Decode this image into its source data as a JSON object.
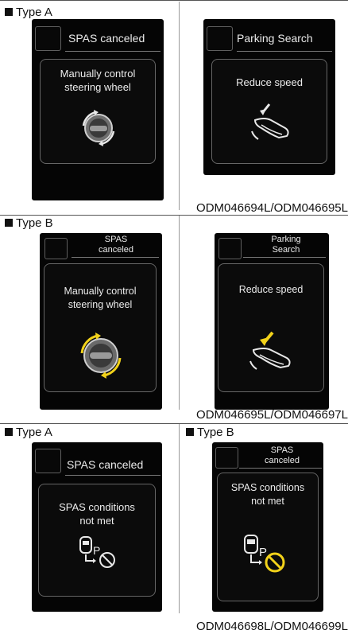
{
  "sections": [
    {
      "label": "Type A",
      "code": "ODM046694L/ODM046695L"
    },
    {
      "label": "Type B",
      "code": "ODM046695L/ODM046697L"
    },
    {
      "label_left": "Type A",
      "label_right": "Type B",
      "code": "ODM046698L/ODM046699L"
    }
  ],
  "screens": {
    "s1": {
      "title": "SPAS canceled",
      "msg_line1": "Manually control",
      "msg_line2": "steering wheel"
    },
    "s2": {
      "title": "Parking Search",
      "msg_line1": "Reduce speed"
    },
    "s3": {
      "title_line1": "SPAS",
      "title_line2": "canceled",
      "msg_line1": "Manually control",
      "msg_line2": "steering wheel"
    },
    "s4": {
      "title_line1": "Parking",
      "title_line2": "Search",
      "msg_line1": "Reduce speed"
    },
    "s5": {
      "title": "SPAS canceled",
      "msg_line1": "SPAS conditions",
      "msg_line2": "not met",
      "icon_letter": "P"
    },
    "s6": {
      "title_line1": "SPAS",
      "title_line2": "canceled",
      "msg_line1": "SPAS conditions",
      "msg_line2": "not met",
      "icon_letter": "P"
    }
  },
  "icons": [
    "steering-wheel-icon",
    "brake-pedal-icon",
    "steering-wheel-icon",
    "brake-pedal-icon",
    "car-parking-prohibited-icon",
    "car-parking-prohibited-icon"
  ],
  "colors": {
    "arrow_white": "#e8e8e8",
    "arrow_yellow": "#f2d21a",
    "screen_bg": "#050505"
  }
}
